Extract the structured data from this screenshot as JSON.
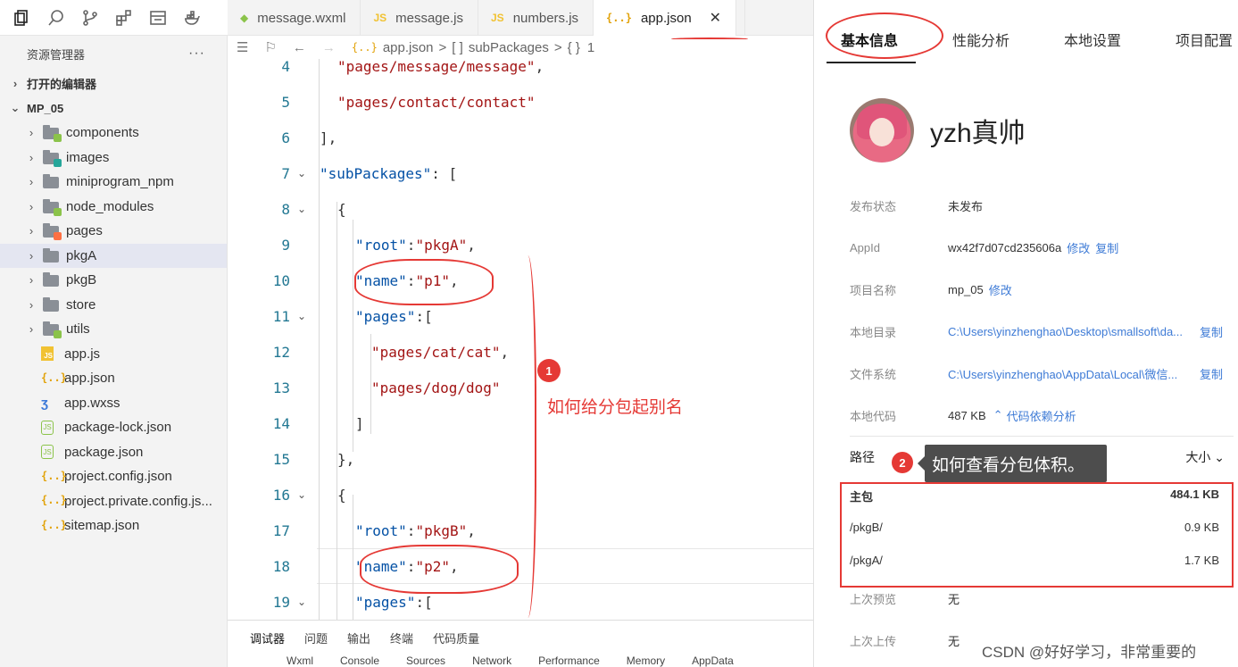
{
  "activity_bar": {
    "items": [
      "files-icon",
      "search-icon",
      "source-control-icon",
      "extensions-icon",
      "layout-icon",
      "docker-icon"
    ]
  },
  "explorer": {
    "title": "资源管理器",
    "more": "···",
    "open_editors_label": "打开的编辑器",
    "project_label": "MP_05",
    "folders": [
      "components",
      "images",
      "miniprogram_npm",
      "node_modules",
      "pages",
      "pkgA",
      "pkgB",
      "store",
      "utils"
    ],
    "selected_folder": "pkgA",
    "files": [
      "app.js",
      "app.json",
      "app.wxss",
      "package-lock.json",
      "package.json",
      "project.config.json",
      "project.private.config.js...",
      "sitemap.json"
    ]
  },
  "tabs": [
    {
      "label": "message.wxml",
      "icon": "wxml-icon"
    },
    {
      "label": "message.js",
      "icon": "js-icon"
    },
    {
      "label": "numbers.js",
      "icon": "js-icon"
    },
    {
      "label": "app.json",
      "icon": "json-icon",
      "active": true,
      "close": "✕"
    }
  ],
  "breadcrumb": {
    "file": "app.json",
    "sep1": ">",
    "arr": "[ ]",
    "key": "subPackages",
    "sep2": ">",
    "obj": "{ }",
    "idx": "1"
  },
  "editor": {
    "lines": [
      {
        "n": "4",
        "text": "\"pages/message/message\","
      },
      {
        "n": "5",
        "text": "\"pages/contact/contact\""
      },
      {
        "n": "6",
        "text": "],"
      },
      {
        "n": "7",
        "text": "\"subPackages\": ["
      },
      {
        "n": "8",
        "text": "{"
      },
      {
        "n": "9",
        "text": "\"root\":\"pkgA\","
      },
      {
        "n": "10",
        "text": "\"name\":\"p1\","
      },
      {
        "n": "11",
        "text": "\"pages\":["
      },
      {
        "n": "12",
        "text": "\"pages/cat/cat\","
      },
      {
        "n": "13",
        "text": "\"pages/dog/dog\""
      },
      {
        "n": "14",
        "text": "]"
      },
      {
        "n": "15",
        "text": "},"
      },
      {
        "n": "16",
        "text": "{"
      },
      {
        "n": "17",
        "text": "\"root\":\"pkgB\","
      },
      {
        "n": "18",
        "text": "\"name\":\"p2\","
      },
      {
        "n": "19",
        "text": "\"pages\":["
      }
    ]
  },
  "annotations": {
    "note1_badge": "1",
    "note1_text": "如何给分包起别名",
    "note2_badge": "2",
    "note2_text": "如何查看分包体积。",
    "watermark": "CSDN @好好学习，非常重要的"
  },
  "bottom_panel": {
    "tabs": [
      "调试器",
      "问题",
      "输出",
      "终端",
      "代码质量"
    ],
    "subtabs": [
      "Wxml",
      "Console",
      "Sources",
      "Network",
      "Performance",
      "Memory",
      "AppData"
    ]
  },
  "details_panel": {
    "tabs": [
      "基本信息",
      "性能分析",
      "本地设置",
      "项目配置"
    ],
    "nickname": "yzh真帅",
    "publish_status_label": "发布状态",
    "publish_status": "未发布",
    "appid_label": "AppId",
    "appid": "wx42f7d07cd235606a",
    "modify": "修改",
    "copy": "复制",
    "project_name_label": "项目名称",
    "project_name": "mp_05",
    "local_dir_label": "本地目录",
    "local_dir": "C:\\Users\\yinzhenghao\\Desktop\\smallsoft\\da...",
    "fs_label": "文件系统",
    "fs_path": "C:\\Users\\yinzhenghao\\AppData\\Local\\微信...",
    "local_code_label": "本地代码",
    "local_code_size": "487 KB",
    "dep_analysis": "代码依赖分析",
    "path_header": "路径",
    "size_header": "大小",
    "packages": [
      {
        "path": "主包",
        "size": "484.1 KB"
      },
      {
        "path": "/pkgB/",
        "size": "0.9 KB"
      },
      {
        "path": "/pkgA/",
        "size": "1.7 KB"
      }
    ],
    "last_preview_label": "上次预览",
    "last_preview": "无",
    "last_upload_label": "上次上传",
    "last_upload": "无"
  },
  "colors": {
    "accent_red": "#e53935",
    "link_blue": "#3e7bd6",
    "json_key": "#0451a5",
    "json_string": "#a31515"
  }
}
